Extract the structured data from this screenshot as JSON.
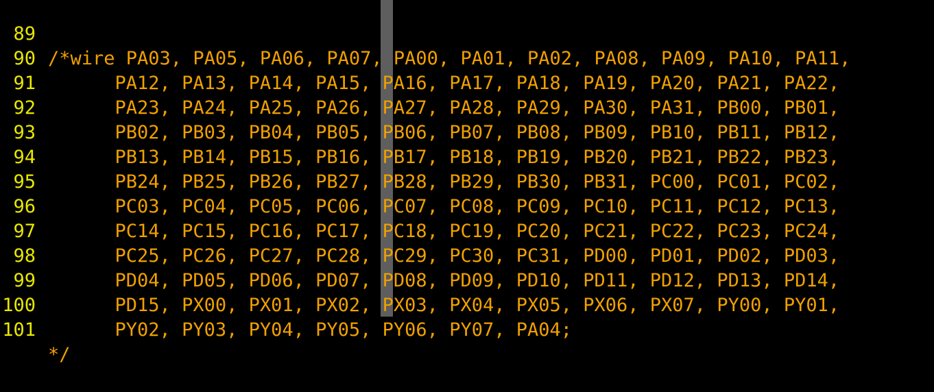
{
  "editor": {
    "lines": [
      {
        "number": "89",
        "text": "/*wire PA03, PA05, PA06, PA07, PA00, PA01, PA02, PA08, PA09, PA10, PA11,"
      },
      {
        "number": "90",
        "text": "      PA12, PA13, PA14, PA15, PA16, PA17, PA18, PA19, PA20, PA21, PA22,"
      },
      {
        "number": "91",
        "text": "      PA23, PA24, PA25, PA26, PA27, PA28, PA29, PA30, PA31, PB00, PB01,"
      },
      {
        "number": "92",
        "text": "      PB02, PB03, PB04, PB05, PB06, PB07, PB08, PB09, PB10, PB11, PB12,"
      },
      {
        "number": "93",
        "text": "      PB13, PB14, PB15, PB16, PB17, PB18, PB19, PB20, PB21, PB22, PB23,"
      },
      {
        "number": "94",
        "text": "      PB24, PB25, PB26, PB27, PB28, PB29, PB30, PB31, PC00, PC01, PC02,"
      },
      {
        "number": "95",
        "text": "      PC03, PC04, PC05, PC06, PC07, PC08, PC09, PC10, PC11, PC12, PC13,"
      },
      {
        "number": "96",
        "text": "      PC14, PC15, PC16, PC17, PC18, PC19, PC20, PC21, PC22, PC23, PC24,"
      },
      {
        "number": "97",
        "text": "      PC25, PC26, PC27, PC28, PC29, PC30, PC31, PD00, PD01, PD02, PD03,"
      },
      {
        "number": "98",
        "text": "      PD04, PD05, PD06, PD07, PD08, PD09, PD10, PD11, PD12, PD13, PD14,"
      },
      {
        "number": "99",
        "text": "      PD15, PX00, PX01, PX02, PX03, PX04, PX05, PX06, PX07, PY00, PY01,"
      },
      {
        "number": "100",
        "text": "      PY02, PY03, PY04, PY05, PY06, PY07, PA04;"
      },
      {
        "number": "101",
        "text": "*/"
      }
    ]
  },
  "colors": {
    "background": "#000000",
    "line_number": "#e8e800",
    "comment": "#f0a000",
    "color_column": "#6e6e6e"
  }
}
